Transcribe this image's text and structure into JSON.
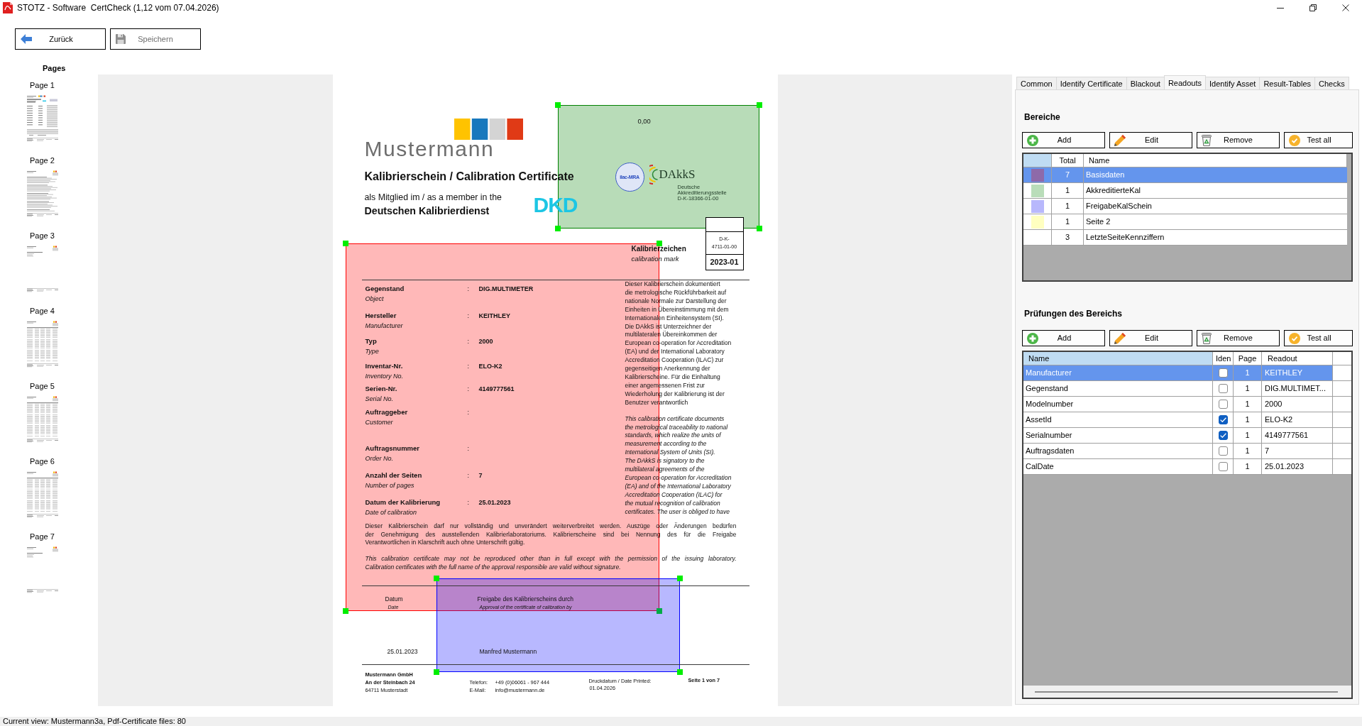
{
  "window": {
    "title": "STOTZ - Software  CertCheck (1,12 vom 07.04.2026)"
  },
  "toolbar": {
    "buttons": [
      {
        "kind": "back",
        "label": "Zurück",
        "disabled": false
      },
      {
        "kind": "save",
        "label": "Speichern",
        "disabled": true
      }
    ]
  },
  "pages_panel": {
    "title": "Pages",
    "pages": [
      {
        "label": "Page 1"
      },
      {
        "label": "Page 2"
      },
      {
        "label": "Page 3"
      },
      {
        "label": "Page 4"
      },
      {
        "label": "Page 5"
      },
      {
        "label": "Page 6"
      },
      {
        "label": "Page 7"
      }
    ]
  },
  "document": {
    "logo_text": "Mustermann",
    "title": "Kalibrierschein / Calibration Certificate",
    "member_line": "als Mitglied im / as a member in the",
    "member_name": "Deutschen Kalibrierdienst",
    "member_logo": "DKD",
    "readout_value": "0,00",
    "seal_text": "ilac-MRA",
    "accreditation": {
      "name": "DAkkS",
      "subtitle": "Deutsche\nAkkreditierungsstelle",
      "number": "D-K-18366-01-00"
    },
    "calibration_mark": {
      "label": "Kalibrierzeichen",
      "sublabel": "calibration mark",
      "code_prefix": "D-K-",
      "code_number": "4711-01-00",
      "year": "2023-01"
    },
    "fields": [
      {
        "label": "Gegenstand",
        "sublabel": "Object",
        "separator": ":",
        "value": "DIG.MULTIMETER"
      },
      {
        "label": "Hersteller",
        "sublabel": "Manufacturer",
        "separator": ":",
        "value": "KEITHLEY"
      },
      {
        "label": "Typ",
        "sublabel": "Type",
        "separator": ":",
        "value": "2000"
      },
      {
        "label": "Inventar-Nr.",
        "sublabel": "Inventory No.",
        "separator": ":",
        "value": "ELO-K2"
      },
      {
        "label": "Serien-Nr.",
        "sublabel": "Serial No.",
        "separator": ":",
        "value": "4149777561"
      },
      {
        "label": "Auftraggeber",
        "sublabel": "Customer",
        "separator": ":"
      },
      {
        "label": "Auftragsnummer",
        "sublabel": "Order No.",
        "separator": ":"
      },
      {
        "label": "Anzahl der Seiten",
        "sublabel": "Number of pages",
        "separator": ":",
        "value": "7"
      },
      {
        "label": "Datum der Kalibrierung",
        "sublabel": "Date of calibration",
        "separator": ":",
        "value": "25.01.2023"
      }
    ],
    "notes": {
      "german": "Dieser Kalibrierschein dokumentiert\ndie metrologische Rückführbarkeit auf\nnationale Normale zur Darstellung der\nEinheiten in Übereinstimmung mit dem\nInternationalen Einheitensystem (SI).\nDie DAkkS ist Unterzeichner der\nmultilateralen Übereinkommen der\nEuropean co-operation for Accreditation\n(EA) und der International Laboratory\nAccreditation Cooperation (ILAC) zur\ngegenseitigen Anerkennung der\nKalibrierscheine. Für die Einhaltung\neiner angemessenen Frist zur\nWiederholung der Kalibrierung ist der\nBenutzer verantwortlich",
      "english": "This calibration certificate documents\nthe metrological traceability to national\nstandards, which realize the units of\nmeasurement according to the\nInternational System of Units (SI).\nThe DAkkS is signatory to the\nmultilateral agreements of the\nEuropean co-operation for Accreditation\n(EA) and of the International Laboratory\nAccreditation Cooperation (ILAC) for\nthe mutual recognition of calibration\ncertificates. The user is obliged to have"
    },
    "legal": {
      "german": "Dieser Kalibrierschein darf nur vollständig und unverändert weiterverbreitet werden. Auszüge oder Änderungen bedürfen\nder Genehmigung des ausstellenden Kalibrierlaboratoriums. Kalibrierscheine sind bei Nennung des für die Freigabe\nVerantwortlichen in Klarschrift auch ohne Unterschrift gültig.",
      "english": "This calibration certificate may not be reproduced other than in full except with the permission of the issuing laboratory.\nCalibration certificates with the full name of the approval responsible are valid without signature."
    },
    "signature": {
      "date_label": "Datum",
      "date_sublabel": "Date",
      "approval_label": "Freigabe des Kalibrierscheins durch",
      "approval_sublabel": "Approval of the certificate of calibration by",
      "date": "25.01.2023",
      "approver": "Manfred Mustermann"
    },
    "footer": {
      "company": [
        {
          "text": "Mustermann GmbH",
          "bold": true
        },
        {
          "text": "An der Steinbach 24",
          "bold": true
        },
        {
          "text": "64711 Musterstadt",
          "bold": false
        }
      ],
      "contacts": [
        {
          "label": "Telefon:",
          "value": "+49 (0)06061 - 967 444"
        },
        {
          "label": "E-Mail:",
          "value": "info@mustermann.de"
        }
      ],
      "print_date_label": "Druckdatum / Date Printed:",
      "print_date": "01.04.2026",
      "page_number": "Seite 1 von 7"
    },
    "overlays": [
      {
        "color": "#ff0000"
      },
      {
        "color": "#008000"
      },
      {
        "color": "#0000ff"
      }
    ]
  },
  "tabs": [
    {
      "label": "Common",
      "selected": false
    },
    {
      "label": "Identify Certificate",
      "selected": false
    },
    {
      "label": "Blackout",
      "selected": false
    },
    {
      "label": "Readouts",
      "selected": true
    },
    {
      "label": "Identify Asset",
      "selected": false
    },
    {
      "label": "Result-Tables",
      "selected": false
    },
    {
      "label": "Checks",
      "selected": false
    }
  ],
  "areas": {
    "title": "Bereiche",
    "buttons": [
      {
        "kind": "add",
        "label": "Add"
      },
      {
        "kind": "edit",
        "label": "Edit"
      },
      {
        "kind": "remove",
        "label": "Remove"
      },
      {
        "kind": "test",
        "label": "Test all"
      }
    ],
    "columns": [
      {
        "highlighted": true
      },
      {
        "label": "Total",
        "highlighted": false
      },
      {
        "label": "Name",
        "highlighted": false
      }
    ],
    "rows": [
      {
        "color": "#8e6aa9",
        "total": "7",
        "name": "Basisdaten",
        "selected": true
      },
      {
        "color": "#b9ddb9",
        "total": "1",
        "name": "AkkreditierteKal",
        "selected": false
      },
      {
        "color": "#b8b8fc",
        "total": "1",
        "name": "FreigabeKalSchein",
        "selected": false
      },
      {
        "color": "#ffffc0",
        "total": "1",
        "name": "Seite 2",
        "selected": false
      },
      {
        "total": "3",
        "name": "LetzteSeiteKennziffern",
        "selected": false
      }
    ]
  },
  "checks": {
    "title": "Prüfungen des Bereichs",
    "buttons": [
      {
        "kind": "add",
        "label": "Add"
      },
      {
        "kind": "edit",
        "label": "Edit"
      },
      {
        "kind": "remove",
        "label": "Remove"
      },
      {
        "kind": "test",
        "label": "Test all"
      }
    ],
    "columns": [
      {
        "label": "Name",
        "highlighted": true
      },
      {
        "label": "Iden",
        "highlighted": false
      },
      {
        "label": "Page",
        "highlighted": false
      },
      {
        "label": "Readout",
        "highlighted": false
      }
    ],
    "rows": [
      {
        "name": "Manufacturer",
        "checked": false,
        "page": "1",
        "readout": "KEITHLEY",
        "selected": true
      },
      {
        "name": "Gegenstand",
        "checked": false,
        "page": "1",
        "readout": "DIG.MULTIMET...",
        "selected": false
      },
      {
        "name": "Modelnumber",
        "checked": false,
        "page": "1",
        "readout": "2000",
        "selected": false
      },
      {
        "name": "AssetId",
        "checked": true,
        "page": "1",
        "readout": "ELO-K2",
        "selected": false
      },
      {
        "name": "Serialnumber",
        "checked": true,
        "page": "1",
        "readout": "4149777561",
        "selected": false
      },
      {
        "name": "Auftragsdaten",
        "checked": false,
        "page": "1",
        "readout": "7",
        "selected": false
      },
      {
        "name": "CalDate",
        "checked": false,
        "page": "1",
        "readout": "25.01.2023",
        "selected": false
      }
    ]
  },
  "status_bar": {
    "text": "Current view: Mustermann3a, Pdf-Certificate files: 80"
  }
}
